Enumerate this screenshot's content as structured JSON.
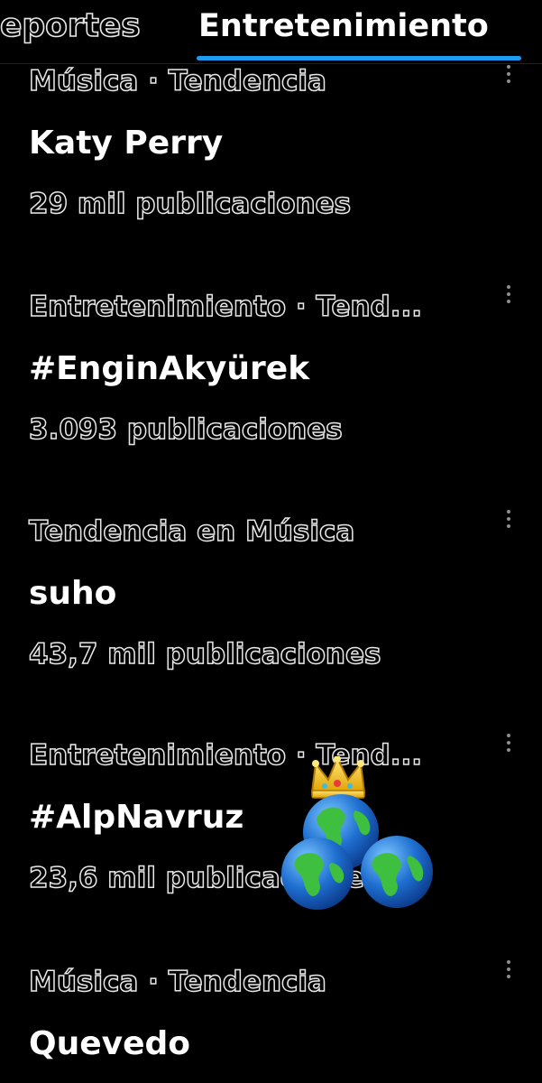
{
  "tabs": [
    {
      "label": "eportes"
    },
    {
      "label": "Entretenimiento",
      "selected": true
    }
  ],
  "accent_color": "#1d9bf0",
  "trends": [
    {
      "context": "Música · Tendencia",
      "name": "Katy Perry",
      "count": "29 mil publicaciones"
    },
    {
      "context": "Entretenimiento · Tend...",
      "name": "#EnginAkyürek",
      "count": "3.093 publicaciones"
    },
    {
      "context": "Tendencia en Música",
      "name": "suho",
      "count": "43,7 mil publicaciones"
    },
    {
      "context": "Entretenimiento · Tend...",
      "name": "#AlpNavruz",
      "count": "23,6 mil publicaciones"
    },
    {
      "context": "Música · Tendencia",
      "name": "Quevedo",
      "count": ""
    }
  ],
  "sticker": {
    "icon": "crowned-globes-sticker"
  }
}
